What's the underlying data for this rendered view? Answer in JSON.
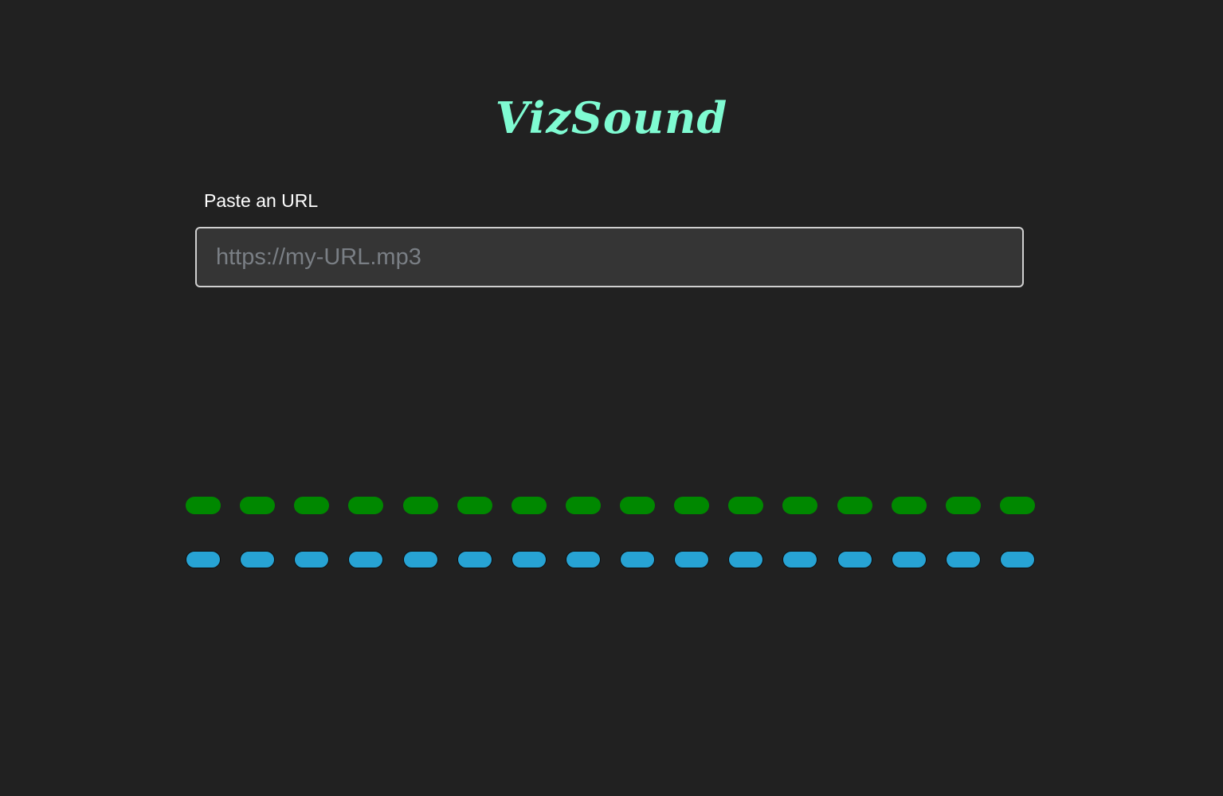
{
  "app": {
    "title": "VizSound"
  },
  "url_form": {
    "label": "Paste an URL",
    "placeholder": "https://my-URL.mp3",
    "value": ""
  },
  "visualizer": {
    "bar_count": 16,
    "top_row_color": "#008800",
    "bottom_row_color": "#27a3d4",
    "top_levels": [
      0.2,
      0.2,
      0.2,
      0.2,
      0.2,
      0.2,
      0.2,
      0.2,
      0.2,
      0.2,
      0.2,
      0.2,
      0.2,
      0.2,
      0.2,
      0.2
    ],
    "bottom_levels": [
      0.2,
      0.2,
      0.2,
      0.2,
      0.2,
      0.2,
      0.2,
      0.2,
      0.2,
      0.2,
      0.2,
      0.2,
      0.2,
      0.2,
      0.2,
      0.2
    ]
  },
  "colors": {
    "background": "#212121",
    "brand": "#7ffbd2",
    "input_background": "#353535",
    "input_border": "#d0d0d0"
  }
}
